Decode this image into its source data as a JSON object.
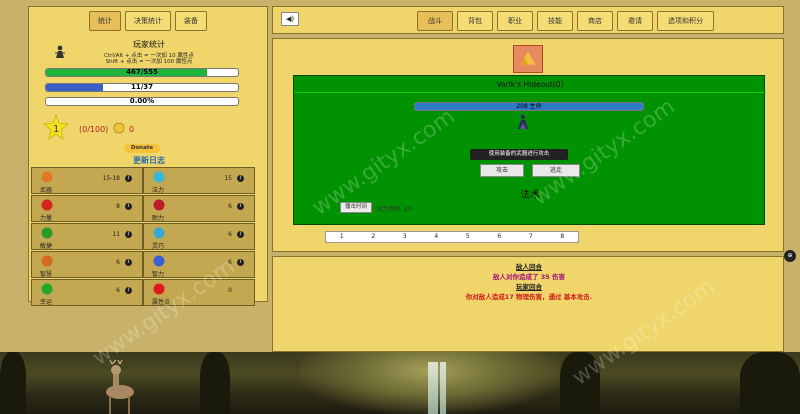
{
  "left": {
    "tabs": [
      "统计",
      "决策统计",
      "装备"
    ],
    "active_tab": 0,
    "title": "玩家统计",
    "hint1": "Ctrl/Alt + 点击 = 一次加 10 属性点",
    "hint2": "Shift + 点击 = 一次加 100 属性点",
    "hp": {
      "label": "467/555",
      "fraction": 0.841,
      "color": "#1fb53a"
    },
    "mp": {
      "label": "11/37",
      "fraction": 0.297,
      "color": "#3a5fc8"
    },
    "xp": {
      "label": "0.00%",
      "fraction": 0.0
    },
    "level": "1",
    "exp_text": "(0/100)",
    "gold": "0",
    "donate_label": "Donate",
    "update_log": "更新日志"
  },
  "stats": [
    {
      "name": "武器",
      "value": "15-18",
      "icon": "fist-icon",
      "color": "#e07a22",
      "info": true
    },
    {
      "name": "法力",
      "value": "15",
      "icon": "swirl-icon",
      "color": "#36b7d6",
      "info": true
    },
    {
      "name": "力量",
      "value": "8",
      "icon": "muscle-icon",
      "color": "#d4261e",
      "info": true
    },
    {
      "name": "耐力",
      "value": "6",
      "icon": "figure-icon",
      "color": "#c01a2a",
      "info": true
    },
    {
      "name": "敏捷",
      "value": "11",
      "icon": "runner-icon",
      "color": "#2a9a2a",
      "info": true
    },
    {
      "name": "灵巧",
      "value": "6",
      "icon": "tool-icon",
      "color": "#3aa7d1",
      "info": true
    },
    {
      "name": "智慧",
      "value": "6",
      "icon": "owl-icon",
      "color": "#d46a22",
      "info": true
    },
    {
      "name": "智力",
      "value": "6",
      "icon": "brain-icon",
      "color": "#3a5fd1",
      "info": true
    },
    {
      "name": "幸运",
      "value": "6",
      "icon": "clover-icon",
      "color": "#21a82a",
      "info": true
    },
    {
      "name": "属性点",
      "value": "0",
      "icon": "plus-icon",
      "color": "#e01a1a",
      "info": false
    }
  ],
  "top_tabs": [
    "战斗",
    "背包",
    "职业",
    "技能",
    "商店",
    "邀请",
    "选项和积分"
  ],
  "active_top_tab": 0,
  "sound_label": "◀)",
  "arena": {
    "location": "Varik's Hideout(0)",
    "enemy_hp_label": "208 生命",
    "enemy_hp_fraction": 1.0,
    "tooltip": "使用装备的武器进行攻击",
    "attack_label": "攻击",
    "flee_label": "逃走",
    "spell_title": "法术",
    "cast_label": "播击时间",
    "mana_text": "法力消耗: 20"
  },
  "pager": [
    "1",
    "2",
    "3",
    "4",
    "5",
    "6",
    "7",
    "8"
  ],
  "log": [
    {
      "type": "head",
      "text": "敌人回合"
    },
    {
      "type": "enemy",
      "text": "敌人对你造成了 35 伤害"
    },
    {
      "type": "head",
      "text": "玩家回合"
    },
    {
      "type": "player",
      "text": "你对敌人造成17 物理伤害，通过 基本攻击."
    }
  ],
  "side_toggle": "⊕",
  "watermark": "www.gityx.com"
}
